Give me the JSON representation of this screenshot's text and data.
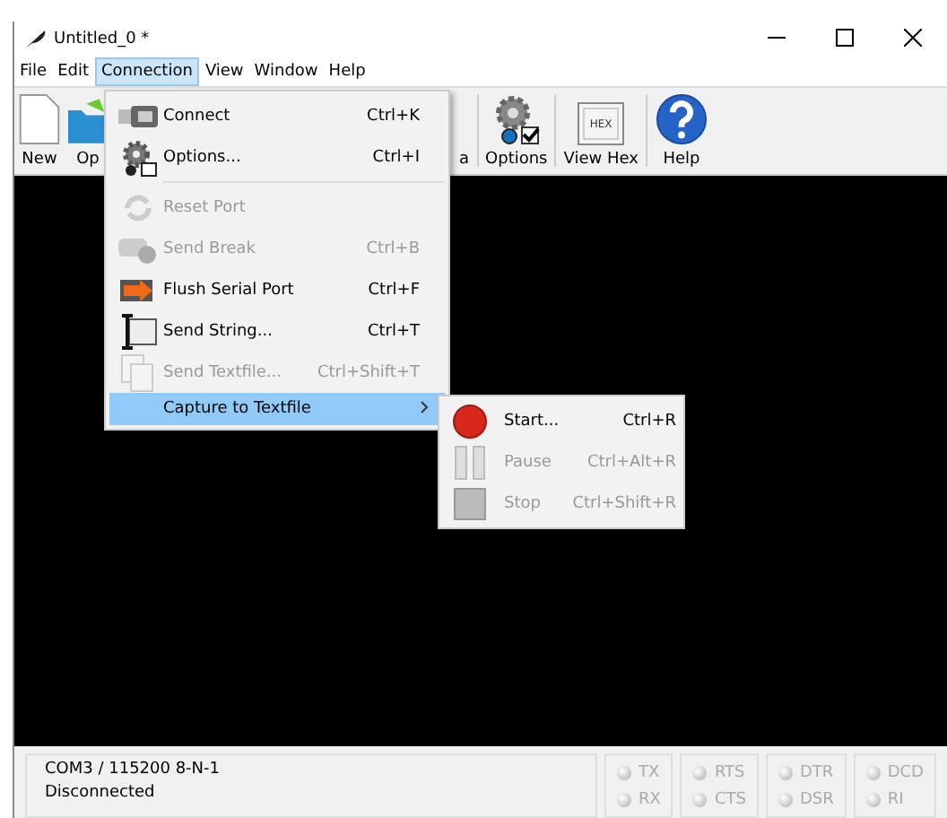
{
  "window": {
    "title": "Untitled_0 *"
  },
  "menu_bar": [
    {
      "label": "File",
      "selected": false
    },
    {
      "label": "Edit",
      "selected": false
    },
    {
      "label": "Connection",
      "selected": true
    },
    {
      "label": "View",
      "selected": false
    },
    {
      "label": "Window",
      "selected": false
    },
    {
      "label": "Help",
      "selected": false
    }
  ],
  "toolbar": {
    "left": [
      {
        "label": "New",
        "kind": "new"
      },
      {
        "label": "Op",
        "kind": "open"
      }
    ],
    "right": [
      {
        "label": "a",
        "kind": "none"
      },
      {
        "label": "Options",
        "kind": "options"
      },
      {
        "label": "View Hex",
        "kind": "hex",
        "icon_text": "HEX"
      },
      {
        "label": "Help",
        "kind": "help"
      }
    ]
  },
  "connection_menu": [
    {
      "kind": "connect",
      "label": "Connect",
      "shortcut": "Ctrl+K",
      "disabled": false,
      "selected": false
    },
    {
      "kind": "options",
      "label": "Options...",
      "shortcut": "Ctrl+I",
      "disabled": false,
      "selected": false,
      "separator_after": true
    },
    {
      "kind": "reset",
      "label": "Reset Port",
      "disabled": true,
      "selected": false
    },
    {
      "kind": "break",
      "label": "Send Break",
      "shortcut": "Ctrl+B",
      "disabled": true,
      "selected": false
    },
    {
      "kind": "flush",
      "label": "Flush Serial Port",
      "shortcut": "Ctrl+F",
      "disabled": false,
      "selected": false
    },
    {
      "kind": "string",
      "label": "Send String...",
      "shortcut": "Ctrl+T",
      "disabled": false,
      "selected": false
    },
    {
      "kind": "textfile",
      "label": "Send Textfile...",
      "shortcut": "Ctrl+Shift+T",
      "disabled": true,
      "selected": false
    },
    {
      "kind": "submenu",
      "label": "Capture to Textfile",
      "disabled": false,
      "selected": true
    }
  ],
  "capture_submenu": [
    {
      "kind": "start",
      "label": "Start...",
      "shortcut": "Ctrl+R",
      "disabled": false
    },
    {
      "kind": "pause",
      "label": "Pause",
      "shortcut": "Ctrl+Alt+R",
      "disabled": true
    },
    {
      "kind": "stop",
      "label": "Stop",
      "shortcut": "Ctrl+Shift+R",
      "disabled": true
    }
  ],
  "status_bar": {
    "lines": [
      "COM3 / 115200 8-N-1",
      "Disconnected"
    ],
    "led_groups": [
      [
        {
          "label": "TX",
          "on": false
        },
        {
          "label": "RX",
          "on": false
        }
      ],
      [
        {
          "label": "RTS",
          "on": false
        },
        {
          "label": "CTS",
          "on": false
        }
      ],
      [
        {
          "label": "DTR",
          "on": false
        },
        {
          "label": "DSR",
          "on": false
        }
      ],
      [
        {
          "label": "DCD",
          "on": false
        },
        {
          "label": "RI",
          "on": false
        }
      ]
    ]
  }
}
